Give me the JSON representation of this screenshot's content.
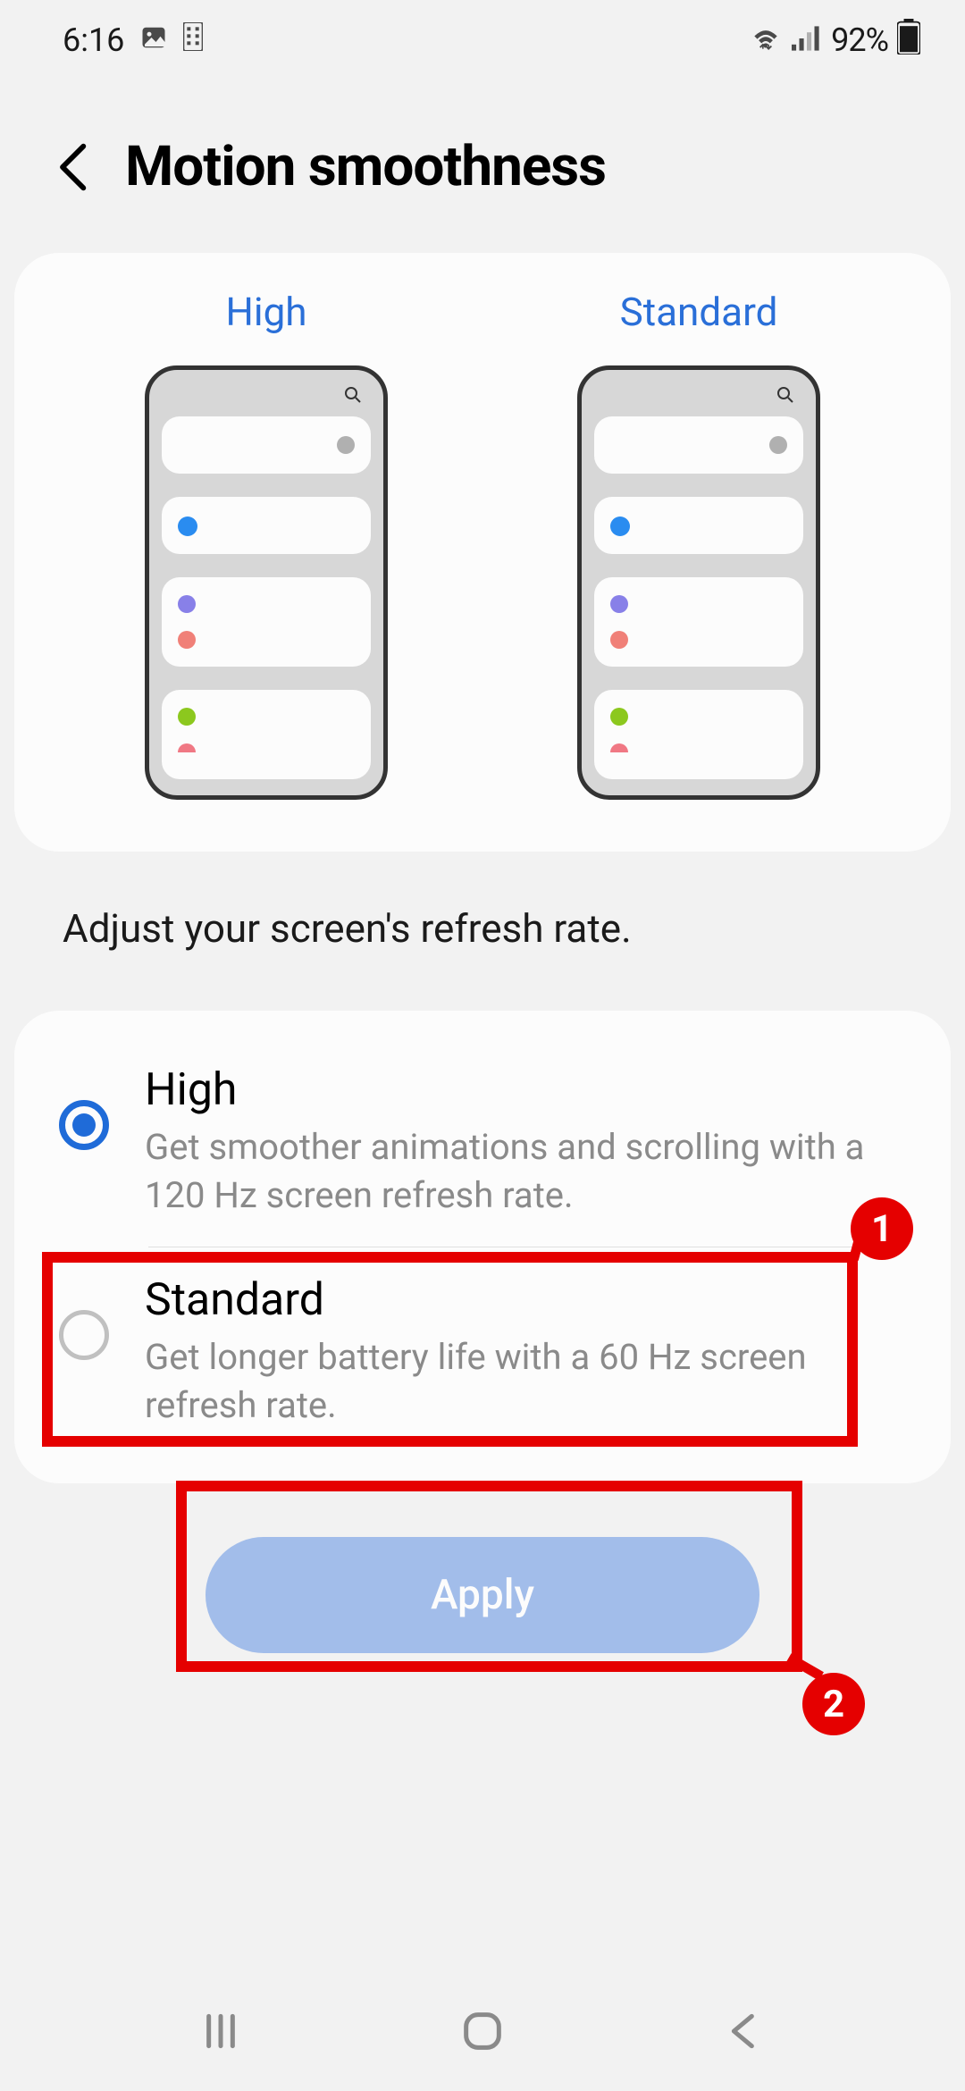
{
  "status": {
    "time": "6:16",
    "battery": "92%"
  },
  "header": {
    "title": "Motion smoothness"
  },
  "preview": {
    "high_label": "High",
    "standard_label": "Standard"
  },
  "description": "Adjust your screen's refresh rate.",
  "options": [
    {
      "title": "High",
      "desc": "Get smoother animations and scrolling with a 120 Hz screen refresh rate.",
      "selected": true
    },
    {
      "title": "Standard",
      "desc": "Get longer battery life with a 60 Hz screen refresh rate.",
      "selected": false
    }
  ],
  "apply_label": "Apply",
  "annotations": {
    "badge1": "1",
    "badge2": "2"
  }
}
